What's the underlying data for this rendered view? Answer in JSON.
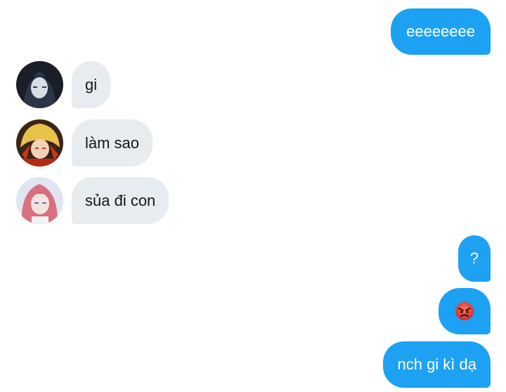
{
  "conversation": {
    "messages": [
      {
        "sender": "self",
        "text": "eeeeeeee"
      },
      {
        "sender": "other",
        "avatar": "dark-hair-anime-avatar",
        "text": "gi"
      },
      {
        "sender": "other",
        "avatar": "blonde-anime-avatar",
        "text": "làm sao"
      },
      {
        "sender": "other",
        "avatar": "pink-hair-anime-avatar",
        "text": "sủa đi con"
      },
      {
        "sender": "self",
        "text": "?"
      },
      {
        "sender": "self",
        "emoji": "angry-face-icon"
      },
      {
        "sender": "self",
        "text": "nch gi kì dạ"
      }
    ]
  },
  "colors": {
    "outgoing_bubble": "#1da1f2",
    "incoming_bubble": "#e6ecf0",
    "outgoing_text": "#ffffff",
    "incoming_text": "#14171a",
    "background": "#ffffff"
  }
}
